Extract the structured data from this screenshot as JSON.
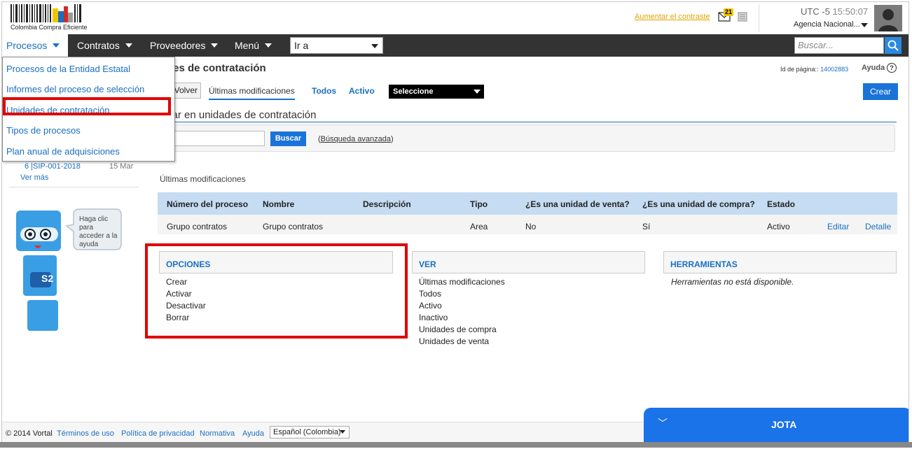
{
  "header": {
    "logo_text": "Colombia Compra Eficiente",
    "contrast_link": "Aumentar el contraste",
    "mail_count": "21",
    "timezone": "UTC -5",
    "time": "15:50:07",
    "agency": "Agencia Nacional..."
  },
  "nav": {
    "items": [
      "Procesos",
      "Contratos",
      "Proveedores",
      "Menú"
    ],
    "goto": "Ir a",
    "search_placeholder": "Buscar..."
  },
  "dropdown": {
    "items": [
      "Procesos de la Entidad Estatal",
      "Informes del proceso de selección",
      "Unidades de contratación",
      "Tipos de procesos",
      "Plan anual de adquisiciones"
    ]
  },
  "page": {
    "title": "des de contratación",
    "page_id_label": "Id de página::",
    "page_id": "14002883",
    "help": "Ayuda",
    "back_button": "Volver",
    "tabs": [
      "Últimas modificaciones",
      "Todos",
      "Activo"
    ],
    "select": "Seleccione",
    "create_button": "Crear"
  },
  "search": {
    "heading": "car en unidades de contratación",
    "button": "Buscar",
    "advanced": "Búsqueda avanzada"
  },
  "sidebar": {
    "item": "6 |SIP-001-2018",
    "date": "15 Mar",
    "more": "Ver más",
    "bubble": "Haga clic para acceder a la ayuda",
    "bot_badge": "S2"
  },
  "results": {
    "label": "Últimas modificaciones",
    "columns": [
      "Número del proceso",
      "Nombre",
      "Descripción",
      "Tipo",
      "¿Es una unidad de venta?",
      "¿Es una unidad de compra?",
      "Estado"
    ],
    "row": {
      "numero": "Grupo contratos",
      "nombre": "Grupo contratos",
      "descripcion": "",
      "tipo": "Area",
      "venta": "No",
      "compra": "Sí",
      "estado": "Activo",
      "edit": "Editar",
      "detail": "Detalle"
    }
  },
  "panels": {
    "opciones": {
      "title": "OPCIONES",
      "items": [
        "Crear",
        "Activar",
        "Desactivar",
        "Borrar"
      ]
    },
    "ver": {
      "title": "VER",
      "items": [
        "Últimas modificaciones",
        "Todos",
        "Activo",
        "Inactivo",
        "Unidades de compra",
        "Unidades de venta"
      ]
    },
    "herramientas": {
      "title": "HERRAMIENTAS",
      "note": "Herramientas no está disponible."
    }
  },
  "footer": {
    "copyright": "© 2014 Vortal",
    "links": [
      "Términos de uso",
      "Política de privacidad",
      "Normativa",
      "Ayuda"
    ],
    "language": "Español (Colombia)"
  },
  "chat": {
    "title": "JOTA"
  },
  "colors": {
    "accent": "#1a73d9",
    "nav_bg": "#333333",
    "highlight": "#e00000"
  }
}
